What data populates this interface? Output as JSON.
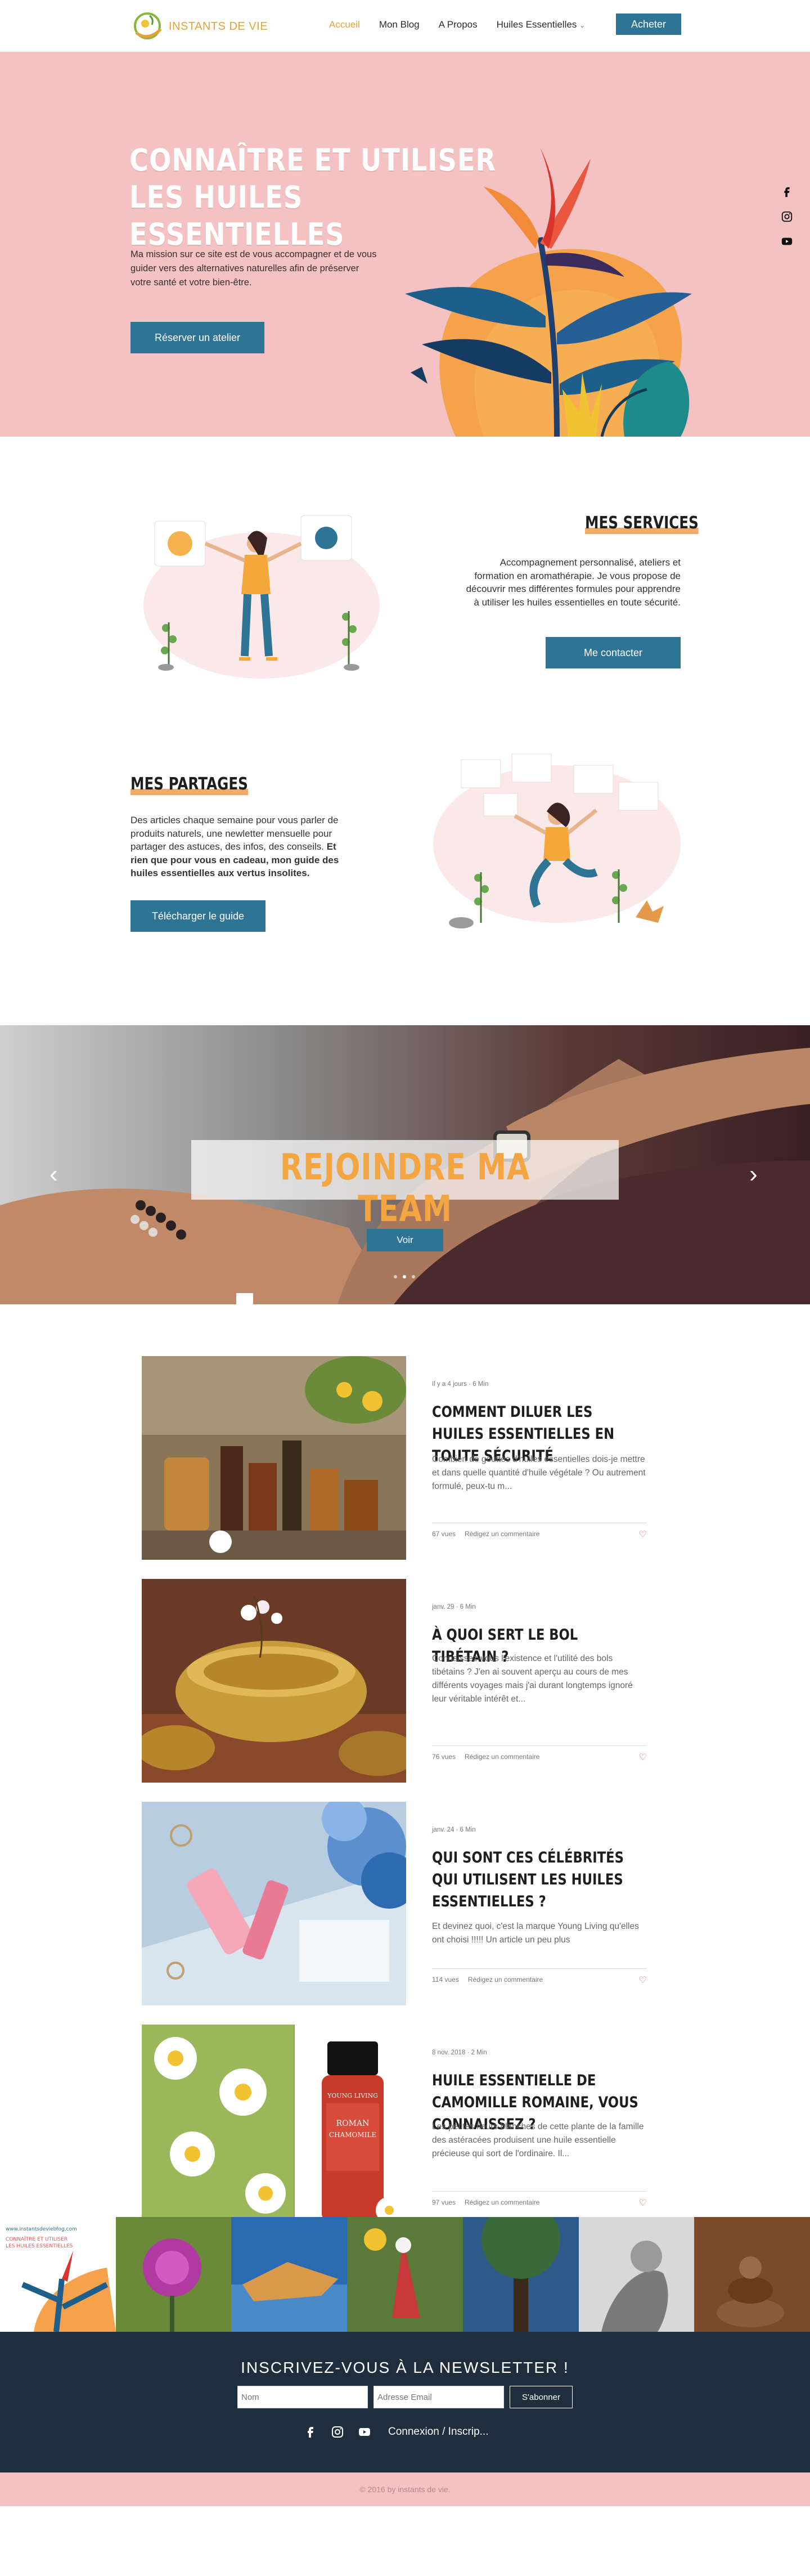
{
  "header": {
    "logo_text": "INSTANTS DE VIE",
    "nav": [
      "Accueil",
      "Mon Blog",
      "A Propos",
      "Huiles Essentielles"
    ],
    "buy_label": "Acheter"
  },
  "hero": {
    "title_line1": "CONNAÎTRE ET UTILISER",
    "title_line2": "LES HUILES ESSENTIELLES",
    "text": "Ma mission sur ce site est de vous accompagner et de vous guider vers des alternatives naturelles afin de préserver votre santé et votre bien-être.",
    "button": "Réserver un atelier"
  },
  "services": {
    "title": "MES SERVICES",
    "text": "Accompagnement personnalisé, ateliers et formation en aromathérapie. Je vous propose de découvrir mes différentes formules pour apprendre à utiliser les huiles essentielles en toute sécurité.",
    "button": "Me contacter"
  },
  "partages": {
    "title": "MES PARTAGES",
    "text": "Des articles chaque semaine pour vous parler de produits naturels, une newletter mensuelle pour partager des astuces, des infos, des conseils.",
    "text_bold": "Et rien que pour vous en cadeau, mon guide des huiles essentielles aux vertus insolites.",
    "button": "Télécharger le guide"
  },
  "carousel": {
    "title": "REJOINDRE MA TEAM",
    "button": "Voir"
  },
  "posts": [
    {
      "meta": "Il y a 4 jours · 6 Min",
      "title": "COMMENT DILUER LES HUILES ESSENTIELLES EN TOUTE SÉCURITÉ",
      "excerpt": "Combien de gouttes d'huiles essentielles dois-je mettre et dans quelle quantité d'huile végétale ? Ou autrement formulé, peux-tu m...",
      "views": "67 vues",
      "comment": "Rédigez un commentaire"
    },
    {
      "meta": "janv. 29 · 6 Min",
      "title": "À QUOI SERT LE BOL TIBÉTAIN ?",
      "excerpt": "Connaissez-vous l'existence et l'utilité des bols tibétains ? J'en ai souvent aperçu au cours de mes différents voyages mais j'ai durant longtemps ignoré leur véritable intérêt et...",
      "views": "76 vues",
      "comment": "Rédigez un commentaire"
    },
    {
      "meta": "janv. 24 · 6 Min",
      "title": "QUI SONT CES CÉLÉBRITÉS QUI UTILISENT LES HUILES ESSENTIELLES ?",
      "excerpt": "Et devinez quoi, c'est la marque Young Living qu'elles ont choisi !!!!! Un article un peu plus",
      "views": "114 vues",
      "comment": "Rédigez un commentaire"
    },
    {
      "meta": "8 nov. 2018 · 2 Min",
      "title": "HUILE ESSENTIELLE DE CAMOMILLE ROMAINE, VOUS CONNAISSEZ ?",
      "excerpt": "Les petites fleurs blanches de cette plante de la famille des astéracées produisent une huile essentielle précieuse qui sort de l'ordinaire. Il...",
      "views": "97 vues",
      "comment": "Rédigez un commentaire"
    }
  ],
  "bottle_label": {
    "brand": "YOUNG LIVING",
    "name1": "ROMAN",
    "name2": "CHAMOMILE"
  },
  "insta_tile_text": [
    "www.instantsdeviebfog.com",
    "CONNAÎTRE ET UTILISER",
    "LES HUILES ESSENTIELLES"
  ],
  "newsletter": {
    "title": "INSCRIVEZ-VOUS À LA NEWSLETTER !",
    "name_placeholder": "Nom",
    "email_placeholder": "Adresse Email",
    "subscribe": "S'abonner",
    "login": "Connexion / Inscrip..."
  },
  "copyright": "© 2016 by instants de vie.",
  "colors": {
    "accent": "#e3a33b",
    "button": "#2e7495",
    "hero_bg": "#f4c2c2",
    "footer_bg": "#1f2d3c",
    "highlight": "#f3ab6c"
  }
}
